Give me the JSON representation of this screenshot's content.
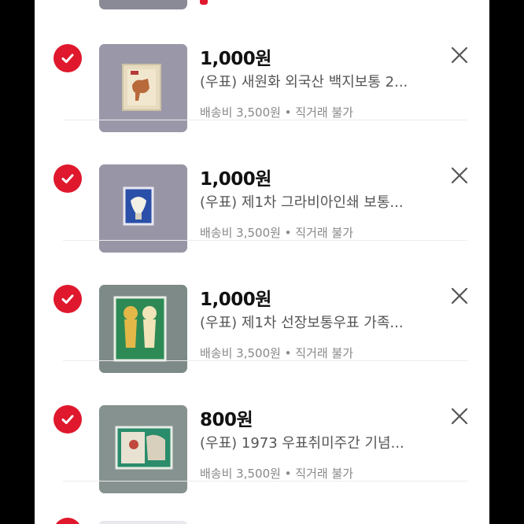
{
  "colors": {
    "accent": "#e0182d",
    "price": "#111111",
    "title": "#555555",
    "meta": "#888888"
  },
  "items": [
    {
      "price": "1,000원",
      "title": "(우표) 새원화 외국산 백지보통 2...",
      "meta": "배송비 3,500원 • 직거래 불가",
      "checked": true,
      "icon": "check-icon"
    },
    {
      "price": "1,000원",
      "title": "(우표) 제1차 그라비아인쇄 보통...",
      "meta": "배송비 3,500원 • 직거래 불가",
      "checked": true,
      "icon": "check-icon"
    },
    {
      "price": "1,000원",
      "title": "(우표) 제1차 선장보통우표 가족...",
      "meta": "배송비 3,500원 • 직거래 불가",
      "checked": true,
      "icon": "check-icon"
    },
    {
      "price": "800원",
      "title": "(우표) 1973 우표취미주간 기념...",
      "meta": "배송비 3,500원 • 직거래 불가",
      "checked": true,
      "icon": "check-icon"
    }
  ]
}
